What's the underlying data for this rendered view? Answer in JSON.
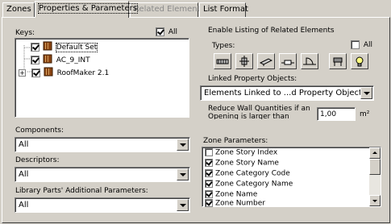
{
  "tabs": [
    {
      "label": "Zones",
      "state": "normal"
    },
    {
      "label": "Properties & Parameters",
      "state": "active"
    },
    {
      "label": "Related Elements",
      "state": "disabled"
    },
    {
      "label": "List Format",
      "state": "normal"
    }
  ],
  "keys": {
    "label": "Keys:",
    "all_label": "All",
    "all_checked": true,
    "items": [
      {
        "label": "Default Set",
        "checked": true,
        "expander": "",
        "selected": true
      },
      {
        "label": "AC_9_INT",
        "checked": true,
        "expander": "",
        "selected": false
      },
      {
        "label": "RoofMaker 2.1",
        "checked": true,
        "expander": "+",
        "selected": false
      }
    ]
  },
  "components": {
    "label": "Components:",
    "value": "All"
  },
  "descriptors": {
    "label": "Descriptors:",
    "value": "All"
  },
  "library_params": {
    "label": "Library Parts' Additional Parameters:",
    "value": "All"
  },
  "related": {
    "heading": "Enable Listing of Related Elements",
    "types_label": "Types:",
    "types_all_label": "All",
    "types_all_checked": false,
    "type_icons": [
      "wall-type-icon",
      "column-type-icon",
      "beam-type-icon",
      "window-type-icon",
      "door-type-icon",
      "object-type-icon",
      "lamp-type-icon"
    ],
    "linked_label": "Linked Property Objects:",
    "linked_value": "Elements Linked to ...d Property Objects",
    "reduce_label_line1": "Reduce Wall Quantities if an",
    "reduce_label_line2": "Opening is larger than",
    "reduce_value": "1,00",
    "reduce_unit": "m²"
  },
  "zone_params": {
    "label": "Zone Parameters:",
    "items": [
      {
        "label": "Zone Story Index",
        "checked": false
      },
      {
        "label": "Zone Story Name",
        "checked": true
      },
      {
        "label": "Zone Category Code",
        "checked": true
      },
      {
        "label": "Zone Category Name",
        "checked": true
      },
      {
        "label": "Zone Name",
        "checked": true
      },
      {
        "label": "Zone Number",
        "checked": true
      }
    ]
  }
}
